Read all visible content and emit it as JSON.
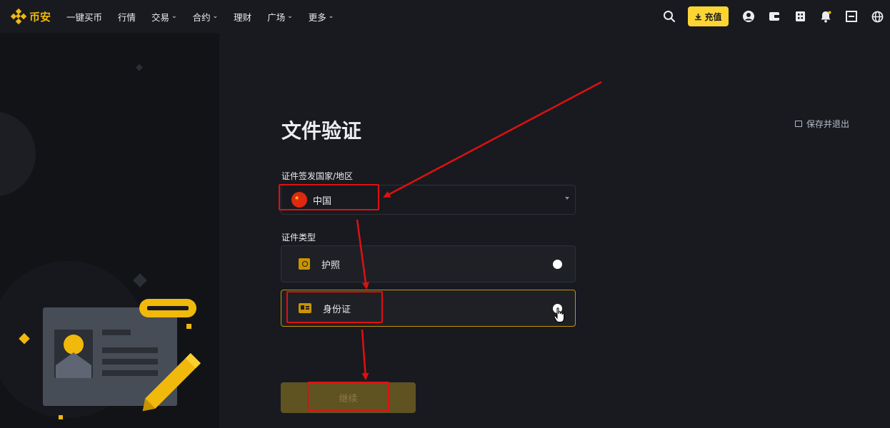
{
  "nav": {
    "logo_text": "币安",
    "items": [
      {
        "label": "一键买币",
        "dropdown": false
      },
      {
        "label": "行情",
        "dropdown": false
      },
      {
        "label": "交易",
        "dropdown": true
      },
      {
        "label": "合约",
        "dropdown": true
      },
      {
        "label": "理财",
        "dropdown": false
      },
      {
        "label": "广场",
        "dropdown": true
      },
      {
        "label": "更多",
        "dropdown": true
      }
    ],
    "deposit_label": "充值",
    "icons": [
      "search-icon",
      "download-icon",
      "user-icon",
      "wallet-icon",
      "orders-icon",
      "bell-icon",
      "qr-icon",
      "globe-icon"
    ]
  },
  "page": {
    "title": "文件验证",
    "save_exit_label": "保存并退出",
    "country_label": "证件签发国家/地区",
    "country_value": "中国",
    "doc_type_label": "证件类型",
    "doc_options": [
      {
        "label": "护照",
        "icon": "passport-icon",
        "selected": false
      },
      {
        "label": "身份证",
        "icon": "id-card-icon",
        "selected": true
      }
    ],
    "continue_label": "继续"
  },
  "colors": {
    "brand": "#f0b90b",
    "background": "#181a20",
    "annotation_red": "#e01010"
  }
}
